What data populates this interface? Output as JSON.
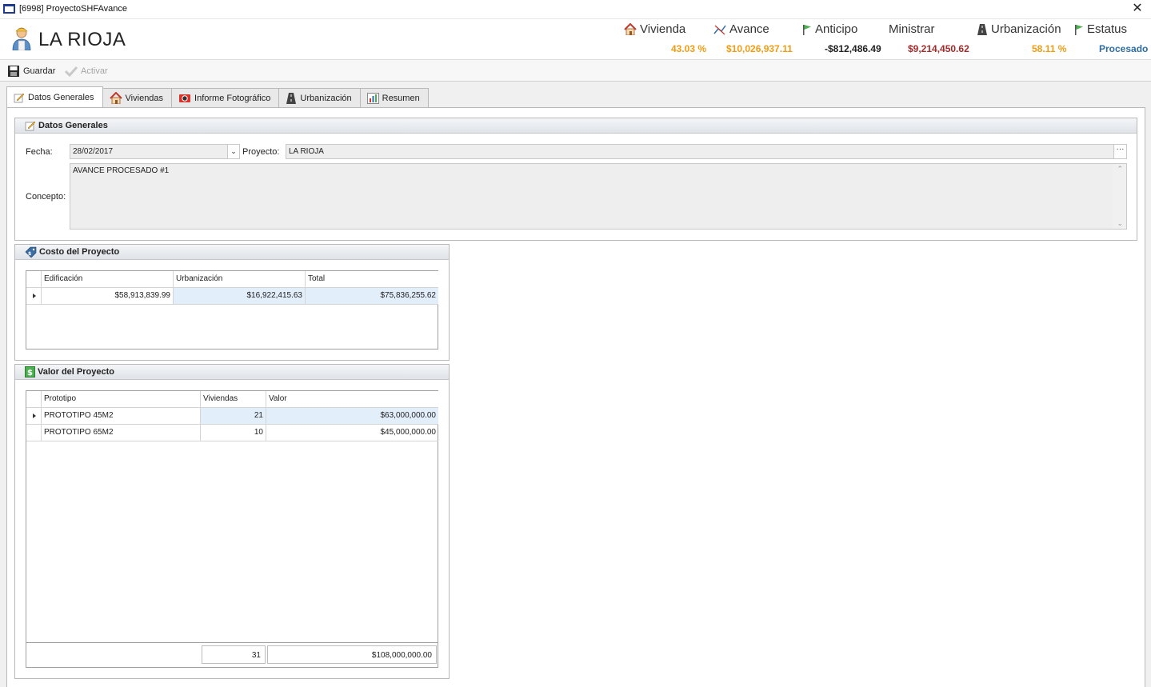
{
  "window": {
    "title": "[6998] ProyectoSHFAvance",
    "close_glyph": "✕"
  },
  "header": {
    "project_title": "LA RIOJA",
    "stats": [
      {
        "label": "Vivienda",
        "icon": "house-icon",
        "value": "43.03 %",
        "color": "#f39c12"
      },
      {
        "label": "Avance",
        "icon": "trend-icon",
        "value": "$10,026,937.11",
        "color": "#f39c12"
      },
      {
        "label": "Anticipo",
        "icon": "flag-icon",
        "value": "-$812,486.49",
        "color": "#222222"
      },
      {
        "label": "Ministrar",
        "icon": "",
        "value": "$9,214,450.62",
        "color": "#a52a2a"
      },
      {
        "label": "Urbanización",
        "icon": "road-icon",
        "value": "58.11 %",
        "color": "#f39c12"
      },
      {
        "label": "Estatus",
        "icon": "flag-icon",
        "value": "Procesado",
        "color": "#2e6da4"
      }
    ]
  },
  "toolbar": {
    "save_label": "Guardar",
    "activate_label": "Activar"
  },
  "tabs": [
    {
      "label": "Datos Generales",
      "icon": "edit-icon",
      "active": true
    },
    {
      "label": "Viviendas",
      "icon": "house-icon",
      "active": false
    },
    {
      "label": "Informe Fotográfico",
      "icon": "camera-icon",
      "active": false
    },
    {
      "label": "Urbanización",
      "icon": "road-icon",
      "active": false
    },
    {
      "label": "Resumen",
      "icon": "bar-chart-icon",
      "active": false
    }
  ],
  "datos_generales": {
    "header": "Datos Generales",
    "fecha_label": "Fecha:",
    "fecha_value": "28/02/2017",
    "proyecto_label": "Proyecto:",
    "proyecto_value": "LA RIOJA",
    "concepto_label": "Concepto:",
    "concepto_value": "AVANCE PROCESADO #1"
  },
  "costo": {
    "header": "Costo del Proyecto",
    "columns": [
      "Edificación",
      "Urbanización",
      "Total"
    ],
    "rows": [
      [
        "$58,913,839.99",
        "$16,922,415.63",
        "$75,836,255.62"
      ]
    ]
  },
  "valor": {
    "header": "Valor del Proyecto",
    "columns": [
      "Prototipo",
      "Viviendas",
      "Valor"
    ],
    "rows": [
      [
        "PROTOTIPO 45M2",
        "21",
        "$63,000,000.00"
      ],
      [
        "PROTOTIPO 65M2",
        "10",
        "$45,000,000.00"
      ]
    ],
    "totals": {
      "viviendas": "31",
      "valor": "$108,000,000.00"
    }
  },
  "colors": {
    "orange": "#f39c12",
    "maroon": "#a52a2a",
    "blue_status": "#2e6da4",
    "selected_row": "#e3eefb"
  }
}
